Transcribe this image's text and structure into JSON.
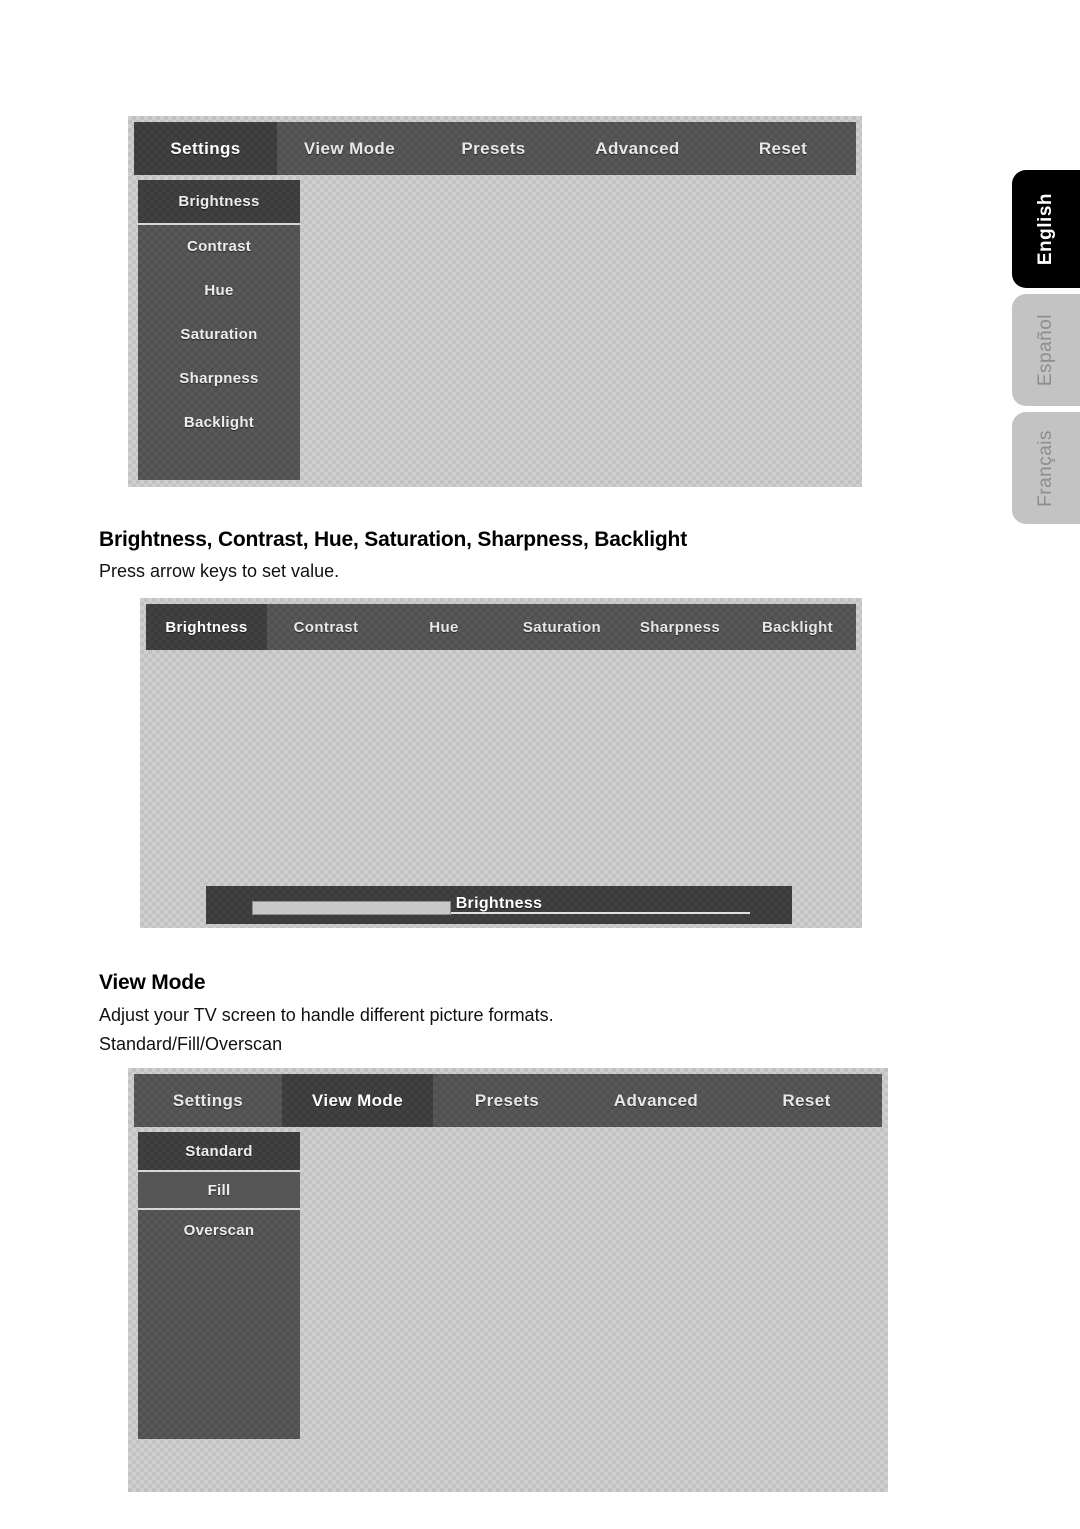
{
  "document": {
    "sections": [
      {
        "heading": "Brightness, Contrast, Hue, Saturation, Sharpness, Backlight",
        "body": "Press arrow keys to set value."
      },
      {
        "heading": "View Mode",
        "body_line1": "Adjust your TV screen to handle different picture formats.",
        "body_line2": "Standard/Fill/Overscan"
      }
    ]
  },
  "osd_settings": {
    "menubar": {
      "items": [
        {
          "label": "Settings",
          "active": true
        },
        {
          "label": "View Mode",
          "active": false
        },
        {
          "label": "Presets",
          "active": false
        },
        {
          "label": "Advanced",
          "active": false
        },
        {
          "label": "Reset",
          "active": false
        }
      ]
    },
    "sidebar": {
      "items": [
        {
          "label": "Brightness",
          "selected": true
        },
        {
          "label": "Contrast",
          "selected": false
        },
        {
          "label": "Hue",
          "selected": false
        },
        {
          "label": "Saturation",
          "selected": false
        },
        {
          "label": "Sharpness",
          "selected": false
        },
        {
          "label": "Backlight",
          "selected": false
        }
      ]
    }
  },
  "osd_brightness": {
    "tabs": {
      "items": [
        {
          "label": "Brightness",
          "active": true
        },
        {
          "label": "Contrast",
          "active": false
        },
        {
          "label": "Hue",
          "active": false
        },
        {
          "label": "Saturation",
          "active": false
        },
        {
          "label": "Sharpness",
          "active": false
        },
        {
          "label": "Backlight",
          "active": false
        }
      ]
    },
    "slider": {
      "label": "Brightness",
      "value_percent": 40
    }
  },
  "osd_viewmode": {
    "menubar": {
      "items": [
        {
          "label": "Settings",
          "active": false
        },
        {
          "label": "View Mode",
          "active": true
        },
        {
          "label": "Presets",
          "active": false
        },
        {
          "label": "Advanced",
          "active": false
        },
        {
          "label": "Reset",
          "active": false
        }
      ]
    },
    "sidebar": {
      "items": [
        {
          "label": "Standard",
          "selected": true
        },
        {
          "label": "Fill",
          "selected": false
        },
        {
          "label": "Overscan",
          "selected": false
        }
      ]
    }
  },
  "language_tabs": {
    "items": [
      {
        "label": "English",
        "active": true
      },
      {
        "label": "Español",
        "active": false
      },
      {
        "label": "Français",
        "active": false
      }
    ]
  },
  "colors": {
    "panel_checker_light": "#cfcfcf",
    "panel_checker_dark": "#c2c2c2",
    "bar_surface": "#585858",
    "bar_surface_active": "#414141",
    "text_light": "#ededed",
    "active_lang_bg": "#000000",
    "inactive_lang_bg": "#c3c3c3"
  }
}
